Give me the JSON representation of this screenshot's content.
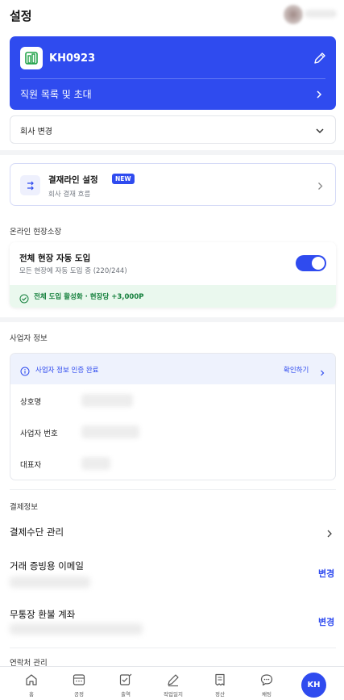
{
  "header": {
    "title": "설정"
  },
  "company": {
    "code": "KH0923",
    "staff_link": "직원 목록 및 초대"
  },
  "company_change": {
    "label": "회사 변경"
  },
  "approval": {
    "title": "결재라인 설정",
    "badge": "NEW",
    "subtitle": "회사 결재 흐름"
  },
  "online_manager": {
    "section_title": "온라인 현장소장",
    "title": "전체 현장 자동 도입",
    "subtitle": "모든 현장에 자동 도입 중 (220/244)",
    "toggle_on": true,
    "benefit": "전체 도입 활성화 · 현장당 +3,000P"
  },
  "business_info": {
    "section_title": "사업자 정보",
    "verified_text": "사업자 정보 인증 완료",
    "verify_link": "확인하기",
    "rows": [
      {
        "label": "상호명"
      },
      {
        "label": "사업자 번호"
      },
      {
        "label": "대표자"
      }
    ]
  },
  "payment": {
    "section_title": "결제정보",
    "method_label": "결제수단 관리",
    "email_label": "거래 증빙용 이메일",
    "email_change": "변경",
    "refund_label": "무통장 환불 계좌",
    "refund_change": "변경"
  },
  "contact": {
    "section_title": "연락처 관리"
  },
  "bottom_nav": {
    "items": [
      {
        "label": "홈",
        "icon": "home-icon"
      },
      {
        "label": "공정",
        "icon": "schedule-icon"
      },
      {
        "label": "출역",
        "icon": "attendance-icon"
      },
      {
        "label": "작업일지",
        "icon": "pencil-icon"
      },
      {
        "label": "정산",
        "icon": "receipt-icon"
      },
      {
        "label": "채팅",
        "icon": "chat-icon"
      }
    ],
    "profile_initials": "KH"
  },
  "colors": {
    "primary": "#2f4bef",
    "success_bg": "#eaf8ee",
    "success_text": "#15803d"
  }
}
